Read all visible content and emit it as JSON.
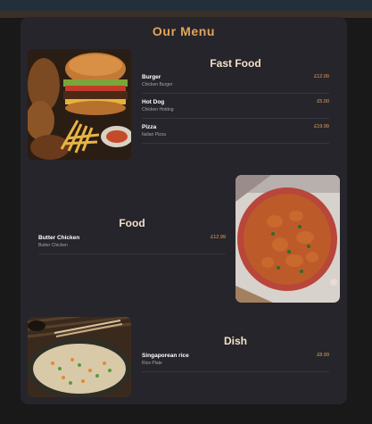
{
  "menu": {
    "title": "Our Menu"
  },
  "colors": {
    "accent": "#e3a55a",
    "card": "#26252b",
    "background": "#191919"
  },
  "sections": [
    {
      "title": "Fast Food",
      "items": [
        {
          "name": "Burger",
          "desc": "Chicken Burger",
          "price": "£12.00"
        },
        {
          "name": "Hot Dog",
          "desc": "Chicken Hotdog",
          "price": "£5.00"
        },
        {
          "name": "Pizza",
          "desc": "Italian Pizza",
          "price": "£19.99"
        }
      ]
    },
    {
      "title": "Food",
      "items": [
        {
          "name": "Butter Chicken",
          "desc": "Butter Chicken",
          "price": "£12.99"
        }
      ]
    },
    {
      "title": "Dish",
      "items": [
        {
          "name": "Singaporean rice",
          "desc": "Rice Plate",
          "price": "£8.99"
        }
      ]
    }
  ]
}
